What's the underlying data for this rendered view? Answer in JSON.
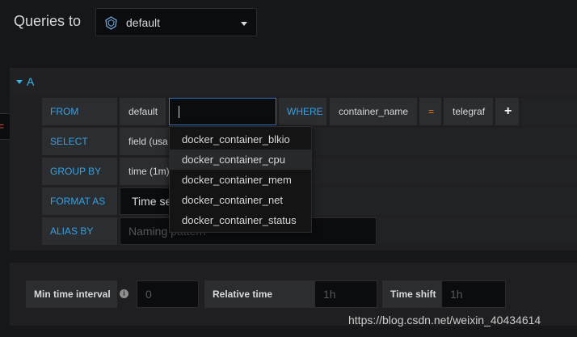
{
  "header": {
    "title": "Queries to",
    "datasource": "default",
    "datasource_icon": "influxdb-icon"
  },
  "query": {
    "ref_letter": "A",
    "edge_tab_glyph": "=",
    "rows": {
      "from": {
        "label": "FROM",
        "policy": "default",
        "measurement_value": "",
        "where_label": "WHERE",
        "tag_key": "container_name",
        "operator": "=",
        "tag_value": "telegraf",
        "add_label": "+"
      },
      "select": {
        "label": "SELECT",
        "field": "field (usa"
      },
      "group_by": {
        "label": "GROUP BY",
        "value": "time (1m)"
      },
      "format_as": {
        "label": "FORMAT AS",
        "value": "Time se"
      },
      "alias_by": {
        "label": "ALIAS BY",
        "placeholder": "Naming pattern"
      }
    }
  },
  "dropdown": {
    "items": [
      "docker_container_blkio",
      "docker_container_cpu",
      "docker_container_mem",
      "docker_container_net",
      "docker_container_status"
    ],
    "highlighted_index": 1
  },
  "options": {
    "min_interval_label": "Min time interval",
    "min_interval_placeholder": "0",
    "relative_time_label": "Relative time",
    "relative_time_placeholder": "1h",
    "time_shift_label": "Time shift",
    "time_shift_placeholder": "1h"
  },
  "watermark": "https://blog.csdn.net/weixin_40434614",
  "colors": {
    "accent": "#33a2e5",
    "operator": "#eb7b18",
    "background": "#161719"
  }
}
